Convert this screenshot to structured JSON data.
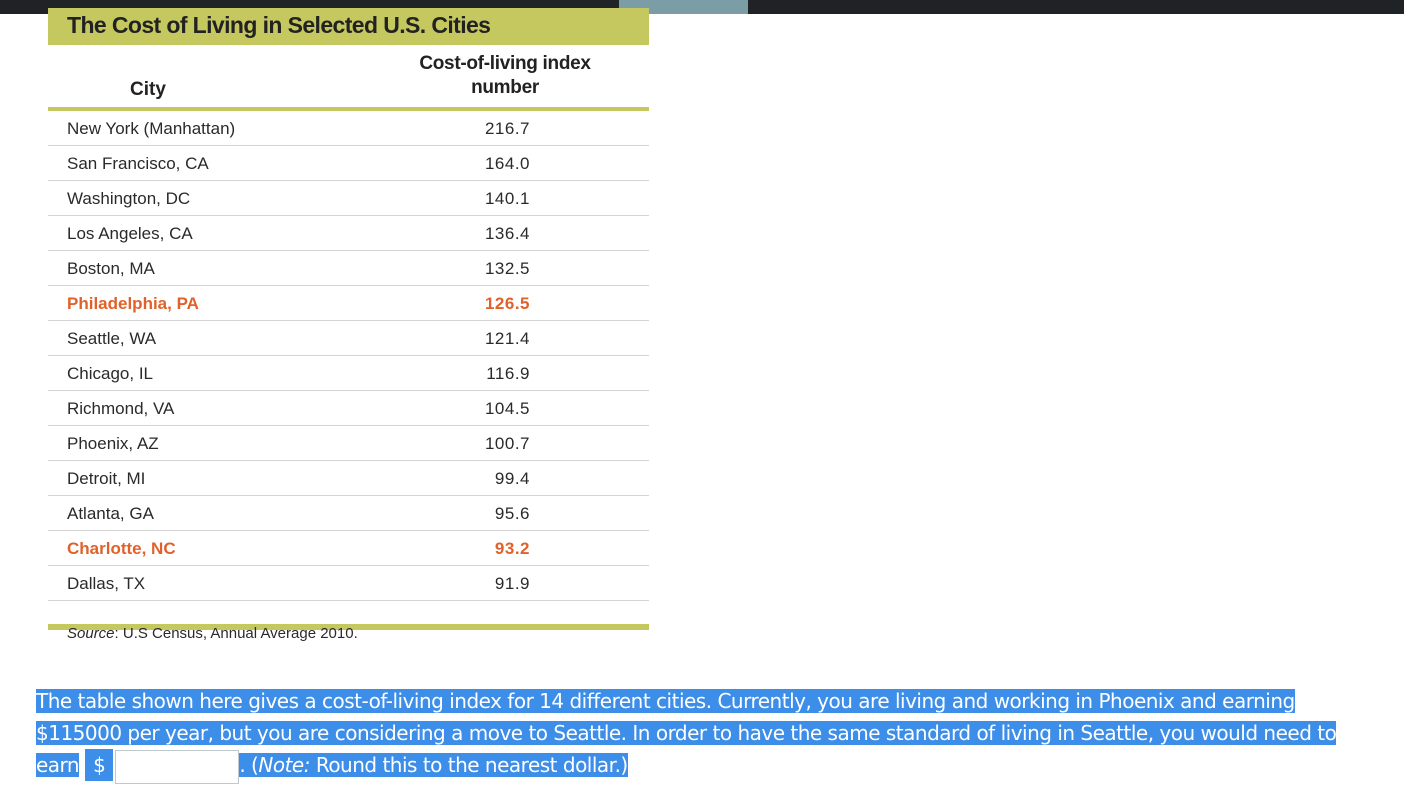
{
  "table": {
    "title": "The Cost of Living in Selected U.S. Cities",
    "col_city": "City",
    "col_index_line1": "Cost-of-living index",
    "col_index_line2": "number",
    "rows": [
      {
        "city": "New York (Manhattan)",
        "value": "216.7"
      },
      {
        "city": "San Francisco, CA",
        "value": "164.0"
      },
      {
        "city": "Washington, DC",
        "value": "140.1"
      },
      {
        "city": "Los Angeles, CA",
        "value": "136.4"
      },
      {
        "city": "Boston, MA",
        "value": "132.5"
      },
      {
        "city": "Philadelphia, PA",
        "value": "126.5"
      },
      {
        "city": "Seattle, WA",
        "value": "121.4"
      },
      {
        "city": "Chicago, IL",
        "value": "116.9"
      },
      {
        "city": "Richmond, VA",
        "value": "104.5"
      },
      {
        "city": "Phoenix, AZ",
        "value": "100.7"
      },
      {
        "city": "Detroit, MI",
        "value": "99.4"
      },
      {
        "city": "Atlanta, GA",
        "value": "95.6"
      },
      {
        "city": "Charlotte, NC",
        "value": "93.2"
      },
      {
        "city": "Dallas, TX",
        "value": "91.9"
      }
    ],
    "source_label": "Source",
    "source_text": ": U.S Census, Annual Average 2010."
  },
  "question": {
    "line1": "The table shown here gives a cost-of-living index for 14 different cities. Currently, you are living and working in Phoenix and earning",
    "line2": "$115000 per year, but you are considering a move to Seattle.  In order to have the same standard of living in Seattle, you would need to",
    "line3_start": "earn",
    "currency": "$",
    "answer_value": "",
    "note_prefix": ". (",
    "note_label": "Note:",
    "note_text": " Round this to the nearest dollar.)"
  },
  "colors": {
    "accent_band": "#c5c85f",
    "highlight_text": "#e0622a",
    "selection": "#3d8ee8",
    "topbar": "#1f2326"
  }
}
